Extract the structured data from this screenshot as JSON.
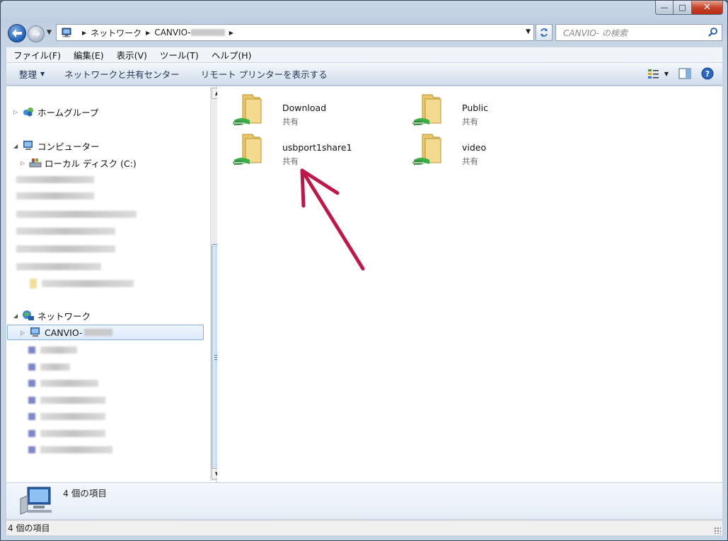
{
  "window": {
    "buttons": {
      "minimize": "—",
      "maximize": "□",
      "close": "✕"
    }
  },
  "address": {
    "crumbs": [
      "ネットワーク",
      "CANVIO-"
    ],
    "search_placeholder": "CANVIO-      の検索"
  },
  "menu": [
    "ファイル(F)",
    "編集(E)",
    "表示(V)",
    "ツール(T)",
    "ヘルプ(H)"
  ],
  "toolbar": {
    "organize": "整理",
    "network_center": "ネットワークと共有センター",
    "remote_printers": "リモート プリンターを表示する"
  },
  "nav": {
    "homegroup": "ホームグループ",
    "computer": "コンピューター",
    "local_disk": "ローカル ディスク (C:)",
    "network": "ネットワーク",
    "canvio": "CANVIO-"
  },
  "files": [
    {
      "name": "Download",
      "desc": "共有"
    },
    {
      "name": "Public",
      "desc": "共有"
    },
    {
      "name": "usbport1share1",
      "desc": "共有"
    },
    {
      "name": "video",
      "desc": "共有"
    }
  ],
  "details": {
    "count": "4 個の項目"
  },
  "status": {
    "count": "4 個の項目"
  },
  "colors": {
    "annotation_arrow": "#c0174a",
    "accent": "#1f5fb8"
  },
  "icons": {
    "back": "back-arrow-icon",
    "forward": "forward-arrow-icon",
    "folder_shared": "shared-folder-icon",
    "network_pc": "network-computer-icon"
  }
}
